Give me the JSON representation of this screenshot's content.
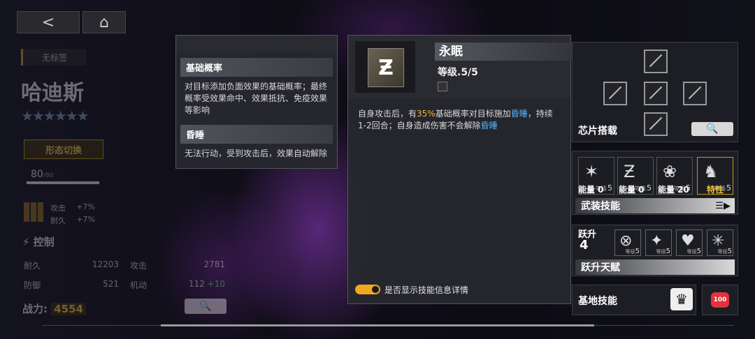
{
  "colors": {
    "accent_yellow": "#f0b340",
    "accent_blue": "#54b7ff",
    "toggle_on": "#f0a81e",
    "heart_red": "#e0323c"
  },
  "character": {
    "tag": "无标签",
    "name": "哈迪斯",
    "stars": "★★★★★★",
    "form_switch": "形态切换",
    "level": "80",
    "level_max": "/80",
    "bonus_attack_label": "攻击",
    "bonus_attack_value": "+7%",
    "bonus_durability_label": "耐久",
    "bonus_durability_value": "+7%",
    "role": "控制",
    "stats": [
      {
        "label": "耐久",
        "value": "12203"
      },
      {
        "label": "攻击",
        "value": "2781"
      },
      {
        "label": "防御",
        "value": "521"
      },
      {
        "label": "机动",
        "value": "112",
        "extra": "+10"
      }
    ],
    "power_label": "战力:",
    "power_value": "4554"
  },
  "tooltip": {
    "sections": [
      {
        "title": "基础概率",
        "text": "对目标添加负面效果的基础概率；最终概率受效果命中、效果抵抗、免疫效果等影响"
      },
      {
        "title": "昏睡",
        "text": "无法行动，受到攻击后，效果自动解除"
      }
    ]
  },
  "skill_popup": {
    "name": "永眠",
    "level": "等级.5/5",
    "desc_part1": "自身攻击后，有",
    "desc_pct": "35%",
    "desc_part2": "基础概率",
    "desc_part3": "对目标施加",
    "desc_kw1": "昏睡",
    "desc_part4": "，持续1-2回合；自身造成伤害不会解除",
    "desc_kw2": "昏睡",
    "toggle_label": "是否显示技能信息详情",
    "toggle_on": true
  },
  "right_panel": {
    "chip_title": "芯片搭载",
    "skills": [
      {
        "level_prefix": "等级",
        "level": "5",
        "label": "能量 0",
        "icon": "claw-icon"
      },
      {
        "level_prefix": "等级",
        "level": "5",
        "label": "能量 0",
        "icon": "sleep-z-icon"
      },
      {
        "level_prefix": "等级",
        "level": "5",
        "label": "能量 20",
        "icon": "flower-icon"
      },
      {
        "level_prefix": "等级",
        "level": "5",
        "label": "特性",
        "icon": "dragon-icon"
      }
    ],
    "armed_skill_label": "武装技能",
    "ascend_label": "跃升",
    "ascend_value": "4",
    "ascend_skills": [
      {
        "level_prefix": "等级",
        "level": "5",
        "icon": "target-icon"
      },
      {
        "level_prefix": "等级",
        "level": "5",
        "icon": "bird-icon"
      },
      {
        "level_prefix": "等级",
        "level": "5",
        "icon": "heart-shield-icon"
      },
      {
        "level_prefix": "等级",
        "level": "5",
        "icon": "spark-icon"
      }
    ],
    "ascend_talent_label": "跃升天赋",
    "base_skill_label": "基地技能",
    "base_heart_value": "100"
  }
}
